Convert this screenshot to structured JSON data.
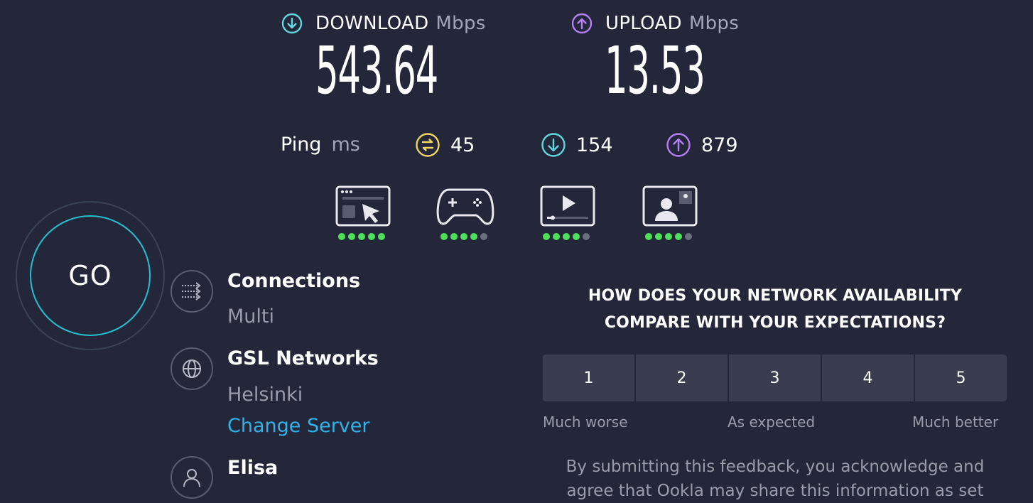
{
  "download": {
    "label": "DOWNLOAD",
    "unit": "Mbps",
    "value": "543.64",
    "icon": "download-arrow-icon",
    "color": "#5fd8e0"
  },
  "upload": {
    "label": "UPLOAD",
    "unit": "Mbps",
    "value": "13.53",
    "icon": "upload-arrow-icon",
    "color": "#b67ff5"
  },
  "ping": {
    "label": "Ping",
    "unit": "ms",
    "idle": {
      "value": "45",
      "icon": "ping-idle-icon",
      "color": "#f2d65e"
    },
    "download": {
      "value": "154",
      "icon": "ping-download-icon",
      "color": "#5fd8e0"
    },
    "upload": {
      "value": "879",
      "icon": "ping-upload-icon",
      "color": "#b67ff5"
    }
  },
  "quality": [
    {
      "name": "web-browsing",
      "icon": "browser-cursor-icon",
      "rating": 5,
      "max": 5
    },
    {
      "name": "gaming",
      "icon": "gamepad-icon",
      "rating": 4,
      "max": 5
    },
    {
      "name": "video-streaming",
      "icon": "video-play-icon",
      "rating": 4,
      "max": 5
    },
    {
      "name": "video-chat",
      "icon": "video-chat-icon",
      "rating": 4,
      "max": 5
    }
  ],
  "go_button": {
    "label": "GO"
  },
  "connections": {
    "title": "Connections",
    "value": "Multi",
    "icon": "connections-arrows-icon"
  },
  "server": {
    "title": "GSL Networks",
    "location": "Helsinki",
    "change_label": "Change Server",
    "icon": "globe-icon"
  },
  "provider": {
    "title": "Elisa",
    "icon": "user-icon"
  },
  "survey": {
    "question_line1": "HOW DOES YOUR NETWORK AVAILABILITY",
    "question_line2": "COMPARE WITH YOUR EXPECTATIONS?",
    "options": [
      "1",
      "2",
      "3",
      "4",
      "5"
    ],
    "low_label": "Much worse",
    "mid_label": "As expected",
    "high_label": "Much better",
    "disclaimer_line1": "By submitting this feedback, you acknowledge and",
    "disclaimer_line2": "agree that Ookla may share this information as set"
  }
}
